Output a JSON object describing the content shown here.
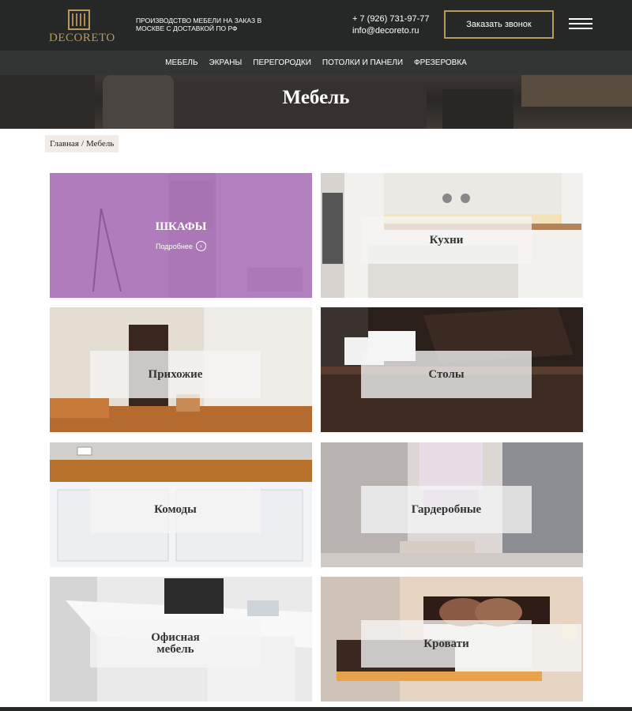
{
  "header": {
    "logo_text": "DECORETO",
    "tagline": "ПРОИЗВОДСТВО МЕБЕЛИ НА ЗАКАЗ В МОСКВЕ С ДОСТАВКОЙ ПО РФ",
    "phone": "+ 7 (926) 731-97-77",
    "email": "info@decoreto.ru",
    "call_button": "Заказать звонок",
    "menu_icon": "burger-menu-icon"
  },
  "nav": {
    "items": [
      {
        "label": "МЕБЕЛЬ"
      },
      {
        "label": "ЭКРАНЫ"
      },
      {
        "label": "ПЕРЕГОРОДКИ"
      },
      {
        "label": "ПОТОЛКИ И ПАНЕЛИ"
      },
      {
        "label": "ФРЕЗЕРОВКА"
      }
    ]
  },
  "hero": {
    "title": "Мебель"
  },
  "breadcrumb": {
    "home": "Главная",
    "separator": "/",
    "current": "Мебель"
  },
  "tiles": [
    {
      "label": "ШКАФЫ",
      "more": "Подробнее",
      "icon": "arrow-right-circle-icon",
      "active": true
    },
    {
      "label": "Кухни"
    },
    {
      "label": "Прихожие"
    },
    {
      "label": "Столы"
    },
    {
      "label": "Комоды"
    },
    {
      "label": "Гардеробные"
    },
    {
      "label": "Офисная мебель"
    },
    {
      "label": "Кровати"
    }
  ],
  "colors": {
    "header_bg": "#262727",
    "nav_bg": "#333434",
    "accent_gold": "#b99a5c",
    "active_overlay": "#a05ab4"
  }
}
